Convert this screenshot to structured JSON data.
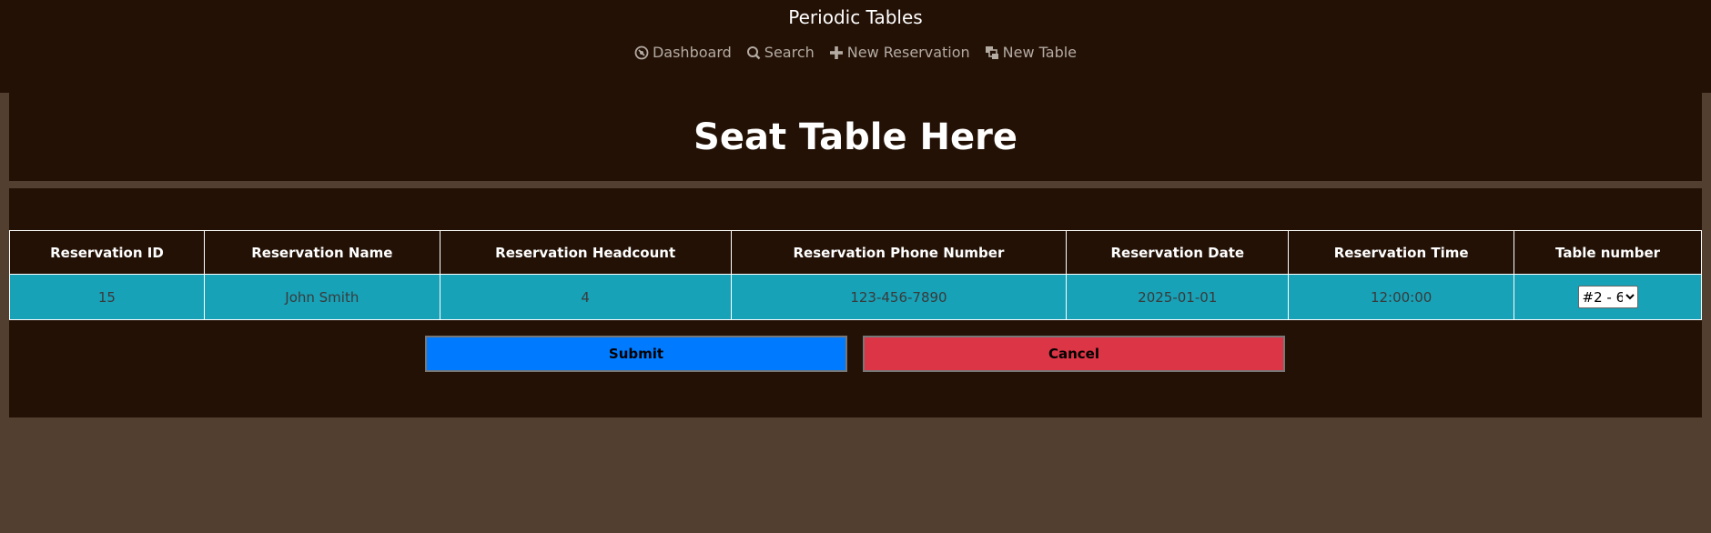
{
  "header": {
    "brand": "Periodic Tables",
    "nav": [
      {
        "label": "Dashboard",
        "icon": "dashboard-icon"
      },
      {
        "label": "Search",
        "icon": "search-icon"
      },
      {
        "label": "New Reservation",
        "icon": "plus-icon"
      },
      {
        "label": "New Table",
        "icon": "layers-icon"
      }
    ]
  },
  "page": {
    "title": "Seat Table Here"
  },
  "table": {
    "columns": [
      "Reservation ID",
      "Reservation Name",
      "Reservation Headcount",
      "Reservation Phone Number",
      "Reservation Date",
      "Reservation Time",
      "Table number"
    ],
    "row": {
      "id": "15",
      "name": "John Smith",
      "headcount": "4",
      "phone": "123-456-7890",
      "date": "2025-01-01",
      "time": "12:00:00",
      "table_selected": "#2 - 6"
    }
  },
  "actions": {
    "submit_label": "Submit",
    "cancel_label": "Cancel"
  },
  "colors": {
    "background": "#533f30",
    "panel": "#231105",
    "row": "#17a2b8",
    "submit": "#007bff",
    "cancel": "#dc3545"
  }
}
